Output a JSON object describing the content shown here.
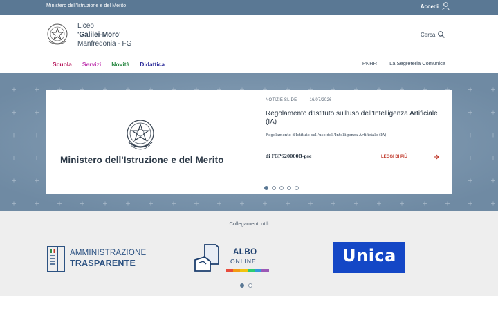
{
  "topbar": {
    "ministry": "Ministero dell'Istruzione e del Merito",
    "login_label": "Accedi",
    "login_icon": "user-icon"
  },
  "header": {
    "school_line1": "Liceo",
    "school_line2": "'Galilei-Moro'",
    "school_line3": "Manfredonia - FG",
    "search_label": "Cerca",
    "search_icon": "search-icon"
  },
  "nav": {
    "items": [
      {
        "label": "Scuola",
        "color": "#b5165a"
      },
      {
        "label": "Servizi",
        "color": "#c23fb2"
      },
      {
        "label": "Novità",
        "color": "#2e8b46"
      },
      {
        "label": "Didattica",
        "color": "#2f2f9c"
      }
    ],
    "right_items": [
      "PNRR",
      "La Segreteria Comunica"
    ]
  },
  "slide": {
    "image_text": "Ministero dell'Istruzione e del Merito",
    "category": "NOTIZIE SLIDE",
    "separator": "—",
    "date": "16/07/2026",
    "title": "Regolamento d'Istituto sull'uso dell'Intelligenza Artificiale (IA)",
    "description": "Regolamento d'Istituto sull'uso dell'Intelligenza Artificiale (IA)",
    "author": "di FGPS20000B-psc",
    "read_more": "LEGGI DI PIÙ",
    "slide_count": 5,
    "active_slide": 1
  },
  "useful_links": {
    "title": "Collegamenti utili",
    "amministrazione_line1": "AMMINISTRAZIONE",
    "amministrazione_line2": "TRASPARENTE",
    "albo_line1": "ALBO",
    "albo_line2": "ONLINE",
    "unica": "Unica",
    "page_count": 2,
    "active_page": 1
  },
  "colors": {
    "topbar": "#5a7894",
    "hero": "#7d96ad",
    "accent_red": "#c0392b",
    "unica_blue": "#1447c6"
  }
}
